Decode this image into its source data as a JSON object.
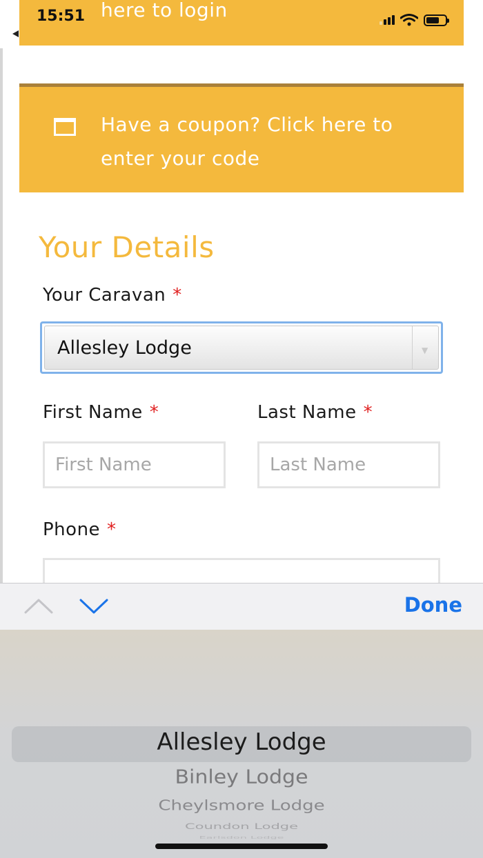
{
  "status_bar": {
    "time": "15:51"
  },
  "login_banner": {
    "text": "here to login"
  },
  "coupon": {
    "text": "Have a coupon? Click here to enter your code",
    "icon": "window-icon"
  },
  "form": {
    "section_title": "Your Details",
    "caravan": {
      "label": "Your Caravan",
      "required_mark": "*",
      "value": "Allesley Lodge"
    },
    "first_name": {
      "label": "First Name",
      "required_mark": "*",
      "placeholder": "First Name"
    },
    "last_name": {
      "label": "Last Name",
      "required_mark": "*",
      "placeholder": "Last Name"
    },
    "phone": {
      "label": "Phone",
      "required_mark": "*"
    }
  },
  "toolbar": {
    "done_label": "Done",
    "prev_icon": "chevron-up-icon",
    "next_icon": "chevron-down-icon"
  },
  "picker": {
    "options": [
      "Allesley Lodge",
      "Binley Lodge",
      "Cheylsmore Lodge",
      "Coundon Lodge",
      "Earlsdon Lodge"
    ],
    "selected_index": 0
  },
  "colors": {
    "accent": "#f4b93d",
    "required": "#e02020",
    "link_blue": "#1a73e8"
  }
}
